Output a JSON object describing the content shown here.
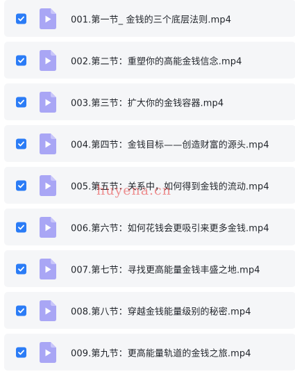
{
  "files": [
    {
      "name": "001.第一节_ 金钱的三个底层法则.mp4",
      "checked": true
    },
    {
      "name": "002.第二节：重塑你的高能金钱信念.mp4",
      "checked": true
    },
    {
      "name": "003.第三节：扩大你的金钱容器.mp4",
      "checked": true
    },
    {
      "name": "004.第四节：金钱目标——创造财富的源头.mp4",
      "checked": true
    },
    {
      "name": "005.第五节：关系中，如何得到金钱的流动.mp4",
      "checked": true
    },
    {
      "name": "006.第六节：如何花钱会更吸引来更多金钱.mp4",
      "checked": true
    },
    {
      "name": "007.第七节：寻找更高能量金钱丰盛之地.mp4",
      "checked": true
    },
    {
      "name": "008.第八节：穿越金钱能量级别的秘密.mp4",
      "checked": true
    },
    {
      "name": "009.第九节：更高能量轨道的金钱之旅.mp4",
      "checked": true
    }
  ],
  "colors": {
    "checkbox": "#2b7cf6",
    "file_icon": "#a9a6f5",
    "row_background": "#f5f6f8",
    "text": "#1f2329"
  },
  "icons": {
    "checkbox": "checkmark-icon",
    "file": "video-file-icon"
  },
  "watermark": "huyena.cn"
}
